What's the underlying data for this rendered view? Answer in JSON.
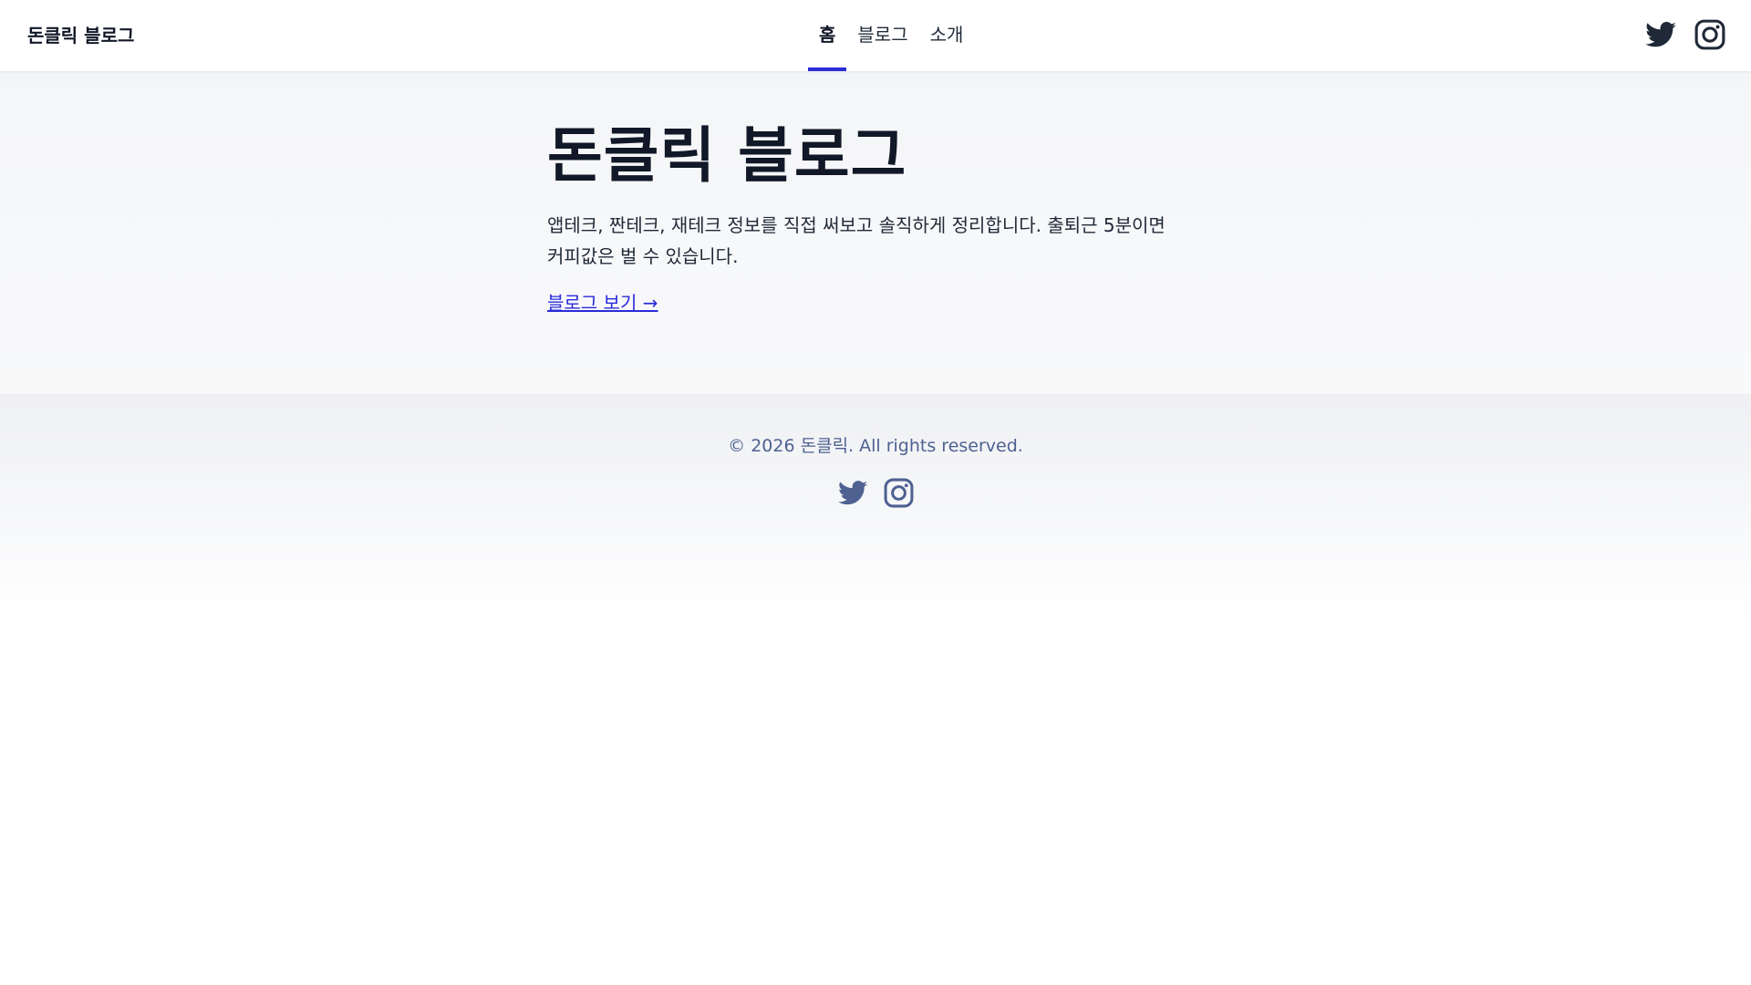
{
  "header": {
    "brand": "돈클릭 블로그",
    "nav": [
      {
        "label": "홈",
        "active": true
      },
      {
        "label": "블로그",
        "active": false
      },
      {
        "label": "소개",
        "active": false
      }
    ],
    "social_icons": [
      "twitter-icon",
      "instagram-icon"
    ]
  },
  "hero": {
    "title": "돈클릭 블로그",
    "description_line1": "앱테크, 짠테크, 재테크 정보를 직접 써보고 솔직하게 정리합니다. 출퇴근 5분이면",
    "description_line2": "커피값은 벌 수 있습니다.",
    "link_label": "블로그 보기 →"
  },
  "footer": {
    "copyright": "© 2026 돈클릭. All rights reserved.",
    "social_icons": [
      "twitter-icon",
      "instagram-icon"
    ]
  },
  "colors": {
    "accent": "#2b2bd8",
    "footer_text": "#4e6191",
    "header_icon": "#1f2937"
  }
}
